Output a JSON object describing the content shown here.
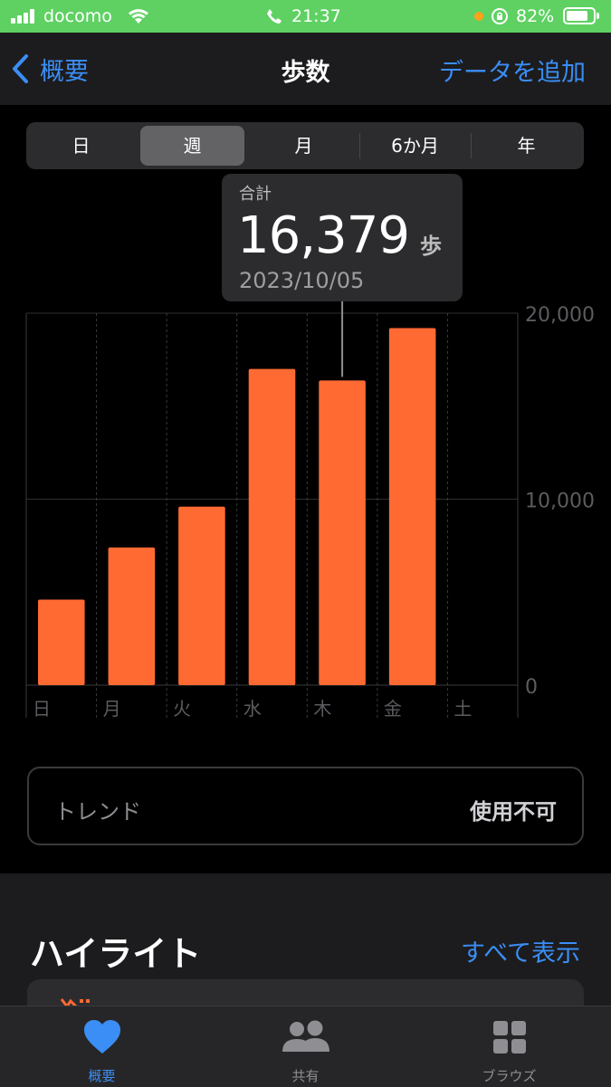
{
  "status_bar": {
    "carrier": "docomo",
    "time": "21:37",
    "battery_percent": "82%",
    "battery_level": 0.82,
    "background_color": "#5fd163"
  },
  "nav": {
    "back_label": "概要",
    "title": "歩数",
    "action_label": "データを追加",
    "accent_color": "#3b8ef5"
  },
  "segments": {
    "items": [
      "日",
      "週",
      "月",
      "6か月",
      "年"
    ],
    "selected": "週"
  },
  "tooltip": {
    "label": "合計",
    "value": "16,379",
    "unit": "歩",
    "date": "2023/10/05"
  },
  "chart_data": {
    "type": "bar",
    "categories": [
      "日",
      "月",
      "火",
      "水",
      "木",
      "金",
      "土"
    ],
    "values": [
      4600,
      7400,
      9600,
      17000,
      16379,
      19200,
      null
    ],
    "y_ticks": [
      {
        "value": 20000,
        "label": "20,000"
      },
      {
        "value": 10000,
        "label": "10,000"
      },
      {
        "value": 0,
        "label": "0"
      }
    ],
    "ylim": [
      0,
      20000
    ],
    "selected_category": "木",
    "bar_color": "#ff6a33",
    "grid": true
  },
  "trend": {
    "label": "トレンド",
    "value": "使用不可"
  },
  "highlights": {
    "title": "ハイライト",
    "link_label": "すべて表示"
  },
  "tab_bar": {
    "tabs": [
      {
        "label": "概要",
        "icon": "heart-icon"
      },
      {
        "label": "共有",
        "icon": "people-icon"
      },
      {
        "label": "ブラウズ",
        "icon": "grid-icon"
      }
    ],
    "active_index": 0
  }
}
